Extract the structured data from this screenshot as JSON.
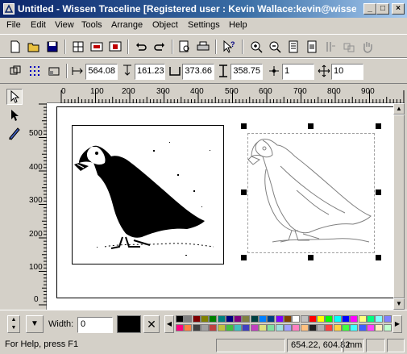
{
  "window": {
    "title": "Untitled - Wissen Traceline  [Registered user : Kevin Wallace:kevin@wisse..."
  },
  "menu": [
    "File",
    "Edit",
    "View",
    "Tools",
    "Arrange",
    "Object",
    "Settings",
    "Help"
  ],
  "position": {
    "x": "564.08",
    "y": "161.23",
    "width": "373.66",
    "height": "358.75",
    "field5": "1",
    "field6": "10"
  },
  "ruler": {
    "h_labels": [
      "0",
      "100",
      "200",
      "300",
      "400",
      "500",
      "600",
      "700",
      "800",
      "900"
    ],
    "v_labels": [
      "500",
      "400",
      "300",
      "200",
      "100",
      "0"
    ]
  },
  "outline": {
    "width_label": "Width:",
    "width_value": "0"
  },
  "palette": {
    "row1": [
      "#000000",
      "#808080",
      "#800000",
      "#808000",
      "#008000",
      "#008080",
      "#000080",
      "#800080",
      "#808040",
      "#004040",
      "#0080ff",
      "#004080",
      "#8000ff",
      "#804000",
      "#ffffff",
      "#c0c0c0",
      "#ff0000",
      "#ffff00",
      "#00ff00",
      "#00ffff",
      "#0000ff",
      "#ff00ff",
      "#ffff80",
      "#00ff80",
      "#80ffff",
      "#8080ff"
    ],
    "row2": [
      "#ff0080",
      "#ff8040",
      "#404040",
      "#a0a0a0",
      "#c04040",
      "#c0c040",
      "#40c040",
      "#40c0c0",
      "#4040c0",
      "#c040c0",
      "#e0e080",
      "#80e0a0",
      "#a0e0e0",
      "#a0a0ff",
      "#ff80c0",
      "#ffc080",
      "#202020",
      "#b0b0b0",
      "#ff4040",
      "#ffd040",
      "#40ff40",
      "#40ffff",
      "#4060ff",
      "#ff40ff",
      "#fff0c0",
      "#c0ffd0"
    ]
  },
  "status": {
    "help": "For Help, press F1",
    "coords": "654.22, 604.82",
    "unit": "mm"
  }
}
